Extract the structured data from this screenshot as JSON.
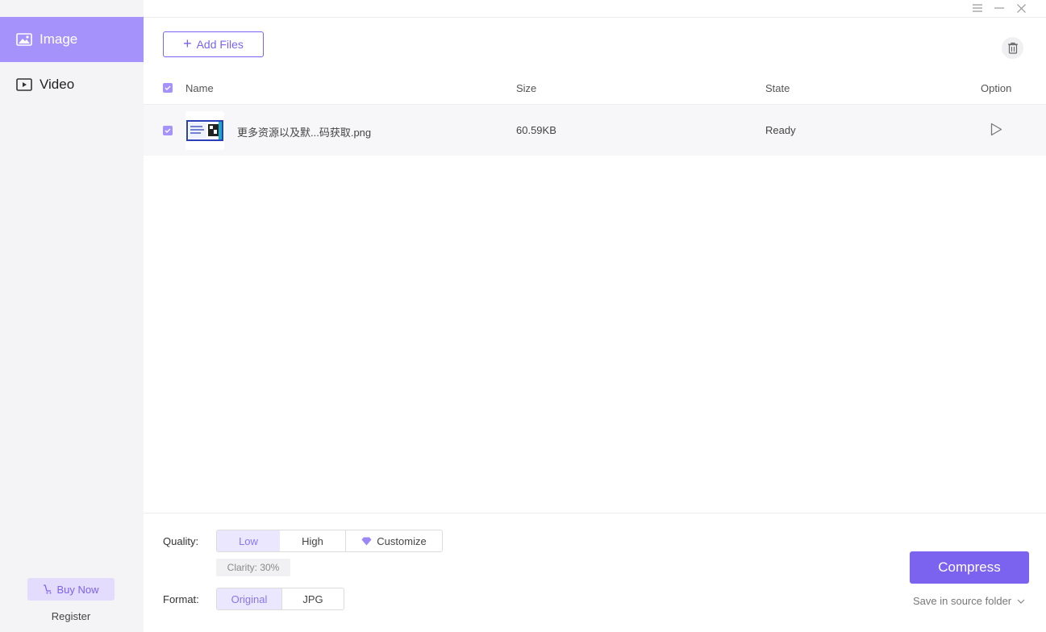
{
  "sidebar": {
    "items": [
      {
        "label": "Image",
        "icon": "image-icon",
        "active": true
      },
      {
        "label": "Video",
        "icon": "video-icon",
        "active": false
      }
    ],
    "buy_now": "Buy Now",
    "register": "Register"
  },
  "toolbar": {
    "add_files": "Add Files"
  },
  "table": {
    "columns": [
      "Name",
      "Size",
      "State",
      "Option"
    ],
    "rows": [
      {
        "name": "更多资源以及默...码获取.png",
        "size": "60.59KB",
        "state": "Ready",
        "checked": true
      }
    ]
  },
  "settings": {
    "quality_label": "Quality:",
    "quality_options": [
      "Low",
      "High",
      "Customize"
    ],
    "quality_selected": "Low",
    "clarity": "Clarity: 30%",
    "format_label": "Format:",
    "format_options": [
      "Original",
      "JPG"
    ],
    "format_selected": "Original"
  },
  "actions": {
    "compress": "Compress",
    "save_location": "Save in source folder"
  },
  "colors": {
    "accent": "#7b63f0",
    "sidebar_active": "#a593fb",
    "sidebar_bg": "#f4f4f7"
  }
}
